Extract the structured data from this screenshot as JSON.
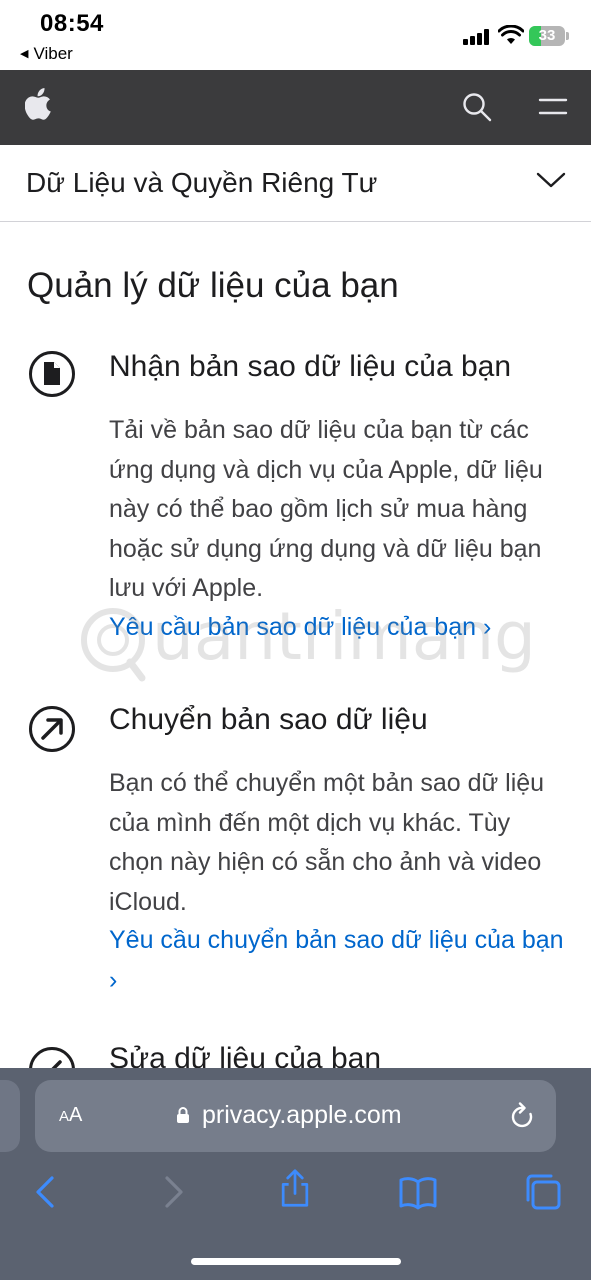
{
  "status_bar": {
    "time": "08:54",
    "back_app": "Viber",
    "battery": "33"
  },
  "apple_nav": {
    "logo_icon": "apple-logo-icon",
    "search_icon": "search-icon",
    "menu_icon": "menu-icon"
  },
  "section": {
    "title": "Dữ Liệu và Quyền Riêng Tư"
  },
  "page": {
    "title": "Quản lý dữ liệu của bạn",
    "items": [
      {
        "icon": "document-icon",
        "heading": "Nhận bản sao dữ liệu của bạn",
        "body": "Tải về bản sao dữ liệu của bạn từ các ứng dụng và dịch vụ của Apple, dữ liệu này có thể bao gồm lịch sử mua hàng hoặc sử dụng ứng dụng và dữ liệu bạn lưu với Apple.",
        "link": "Yêu cầu bản sao dữ liệu của bạn ›"
      },
      {
        "icon": "arrow-up-right-icon",
        "heading": "Chuyển bản sao dữ liệu",
        "body": "Bạn có thể chuyển một bản sao dữ liệu của mình đến một dịch vụ khác. Tùy chọn này hiện có sẵn cho ảnh và video iCloud.",
        "link": "Yêu cầu chuyển bản sao dữ liệu của bạn ›"
      },
      {
        "icon": "edit-icon",
        "heading": "Sửa dữ liệu của bạn"
      }
    ]
  },
  "watermark": {
    "text": "uantrimang"
  },
  "safari": {
    "aa_label_small": "A",
    "aa_label_big": "A",
    "url": "privacy.apple.com",
    "toolbar": [
      "back-icon",
      "forward-icon",
      "share-icon",
      "bookmarks-icon",
      "tabs-icon"
    ]
  },
  "colors": {
    "nav_bg": "#3b3b3d",
    "link": "#0066cc",
    "safari_bar": "#5b6270",
    "toolbar_icon": "#3d8bfd",
    "battery_fill": "#34c759"
  }
}
